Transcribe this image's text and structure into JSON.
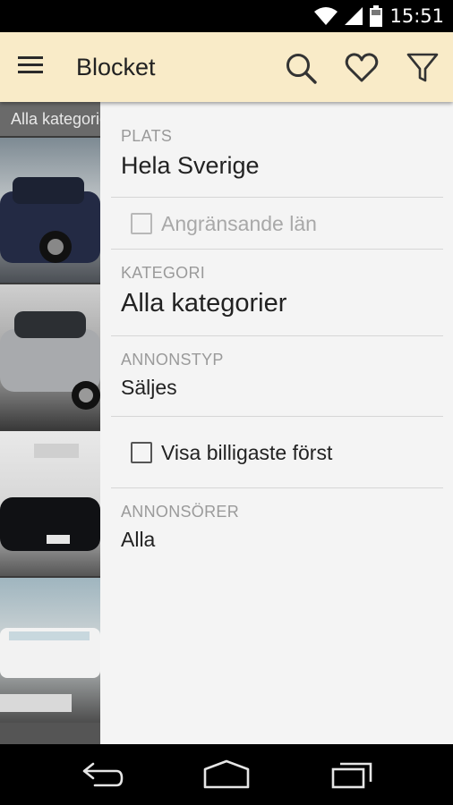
{
  "status_bar": {
    "time": "15:51"
  },
  "app_bar": {
    "title": "Blocket"
  },
  "background_list": {
    "category_header": "Alla kategorier"
  },
  "filters": {
    "plats": {
      "label": "PLATS",
      "value": "Hela Sverige"
    },
    "angransande": {
      "label": "Angränsande län",
      "checked": false
    },
    "kategori": {
      "label": "KATEGORI",
      "value": "Alla kategorier"
    },
    "annonstyp": {
      "label": "ANNONSTYP",
      "value": "Säljes"
    },
    "billigast": {
      "label": "Visa billigaste först",
      "checked": false
    },
    "annonsorer": {
      "label": "ANNONSÖRER",
      "value": "Alla"
    }
  },
  "colors": {
    "app_bar": "#f9ebc8",
    "panel": "#f4f4f4",
    "label": "#9a9a9a",
    "divider": "#d6d6d6"
  }
}
